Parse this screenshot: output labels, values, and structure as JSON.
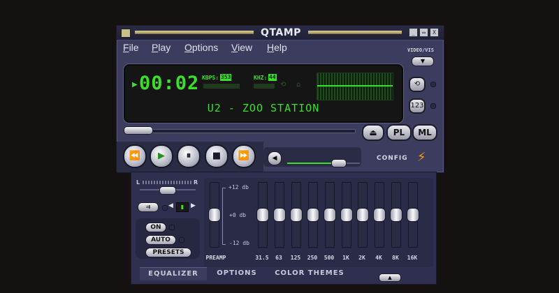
{
  "window": {
    "title": "QTAMP",
    "title_buttons": [
      "_",
      "▭",
      "X"
    ]
  },
  "menu": [
    {
      "label": "File",
      "u": "F",
      "rest": "ile"
    },
    {
      "label": "Play",
      "u": "P",
      "rest": "lay"
    },
    {
      "label": "Options",
      "u": "O",
      "rest": "ptions"
    },
    {
      "label": "View",
      "u": "V",
      "rest": "iew"
    },
    {
      "label": "Help",
      "u": "H",
      "rest": "elp"
    }
  ],
  "display": {
    "time": "00:02",
    "kbps_label": "KBPS:",
    "kbps": "353",
    "khz_label": "KHZ:",
    "khz": "44",
    "song": "U2 - ZOO STATION"
  },
  "side": {
    "video_vis_label": "VIDEO/VIS"
  },
  "buttons": {
    "pl": "PL",
    "ml": "ML",
    "config": "CONFIG"
  },
  "playback": {
    "volume_fraction": 0.72
  },
  "equalizer": {
    "balance_labels": [
      "L",
      "R"
    ],
    "toggles": {
      "on": "ON",
      "auto": "AUTO",
      "presets": "PRESETS"
    },
    "db_labels": [
      "+12 db",
      "+0 db",
      "-12 db"
    ],
    "preamp_label": "PREAMP",
    "bands": [
      "31.5",
      "63",
      "125",
      "250",
      "500",
      "1K",
      "2K",
      "4K",
      "8K",
      "16K"
    ]
  },
  "tabs": [
    "EQUALIZER",
    "OPTIONS",
    "COLOR THEMES"
  ],
  "colors": {
    "lcd_green": "#3be02a",
    "panel": "#3b3c5e",
    "gold": "#b8ab70"
  }
}
